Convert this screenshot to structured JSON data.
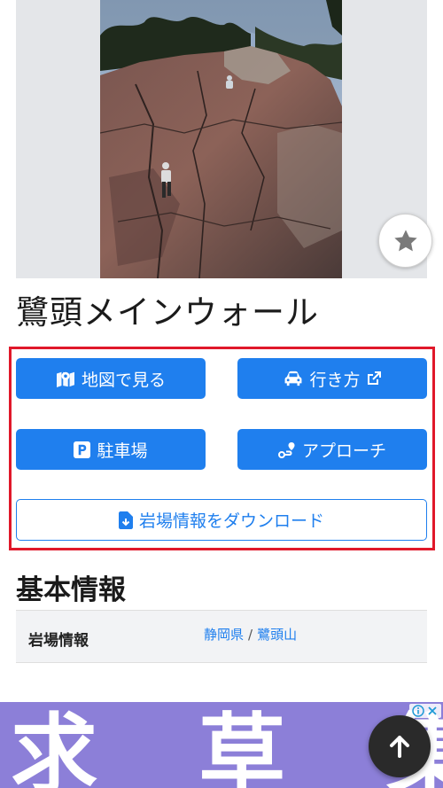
{
  "spot": {
    "title": "鷺頭メインウォール",
    "photo_icon": "climbing-wall-photo",
    "favorite_icon": "star-icon"
  },
  "actions": {
    "map": {
      "label": "地図で見る",
      "icon": "map-marker-icon"
    },
    "directions": {
      "label": "行き方",
      "icon": "car-icon",
      "trailing_icon": "external-link-icon"
    },
    "parking": {
      "label": "駐車場",
      "icon": "parking-icon"
    },
    "approach": {
      "label": "アプローチ",
      "icon": "route-icon"
    },
    "download": {
      "label": "岩場情報をダウンロード",
      "icon": "file-download-icon"
    }
  },
  "basic_info": {
    "heading": "基本情報",
    "rows": [
      {
        "label": "岩場情報",
        "links": [
          "静岡県",
          "鷺頭山"
        ],
        "separator": "/"
      }
    ]
  },
  "ad": {
    "text": "求 草 集",
    "info_icon": "info-icon",
    "close_icon": "close-icon"
  },
  "scroll_top": {
    "icon": "arrow-up-icon"
  },
  "colors": {
    "primary": "#1f7fee",
    "highlight_frame": "#e0182a",
    "ad_background": "#8c7fd8"
  }
}
